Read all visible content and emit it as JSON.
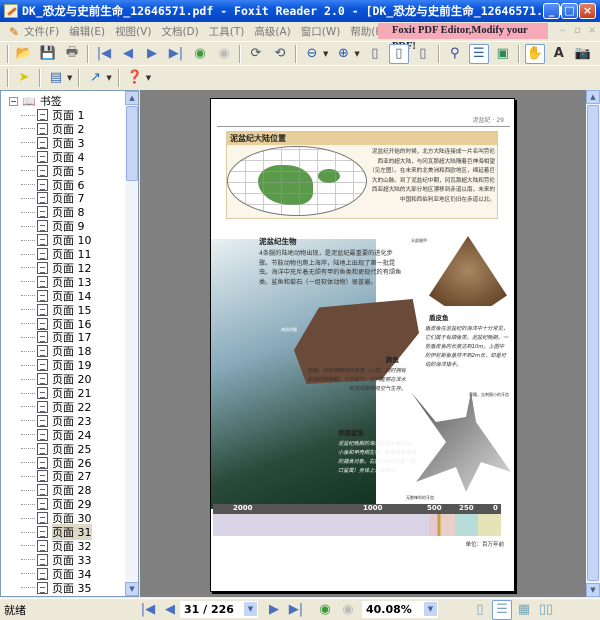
{
  "window": {
    "title": "DK_恐龙与史前生命_12646571.pdf - Foxit Reader 2.0 - [DK_恐龙与史前生命_12646571.pdf]",
    "minimize": "_",
    "maximize": "□",
    "close": "×"
  },
  "menu": [
    "文件(F)",
    "编辑(E)",
    "视图(V)",
    "文档(D)",
    "工具(T)",
    "高级(A)",
    "窗口(W)",
    "帮助(H)"
  ],
  "promo": "Foxit PDF Editor,Modify your PDF!",
  "sidebar": {
    "root": "书签",
    "pages": [
      "页面 1",
      "页面 2",
      "页面 3",
      "页面 4",
      "页面 5",
      "页面 6",
      "页面 7",
      "页面 8",
      "页面 9",
      "页面 10",
      "页面 11",
      "页面 12",
      "页面 13",
      "页面 14",
      "页面 15",
      "页面 16",
      "页面 17",
      "页面 18",
      "页面 19",
      "页面 20",
      "页面 21",
      "页面 22",
      "页面 23",
      "页面 24",
      "页面 25",
      "页面 26",
      "页面 27",
      "页面 28",
      "页面 29",
      "页面 30",
      "页面 31",
      "页面 32",
      "页面 33",
      "页面 34",
      "页面 35"
    ],
    "selected": "页面 31"
  },
  "pdf": {
    "header": "泥盆纪 · 29",
    "map_title": "泥盆纪大陆位置",
    "map_text": "泥盆纪开始的时候，北方大陆连接成一片名叫劳伦西亚的超大陆，与冈瓦那超大陆隔着巨神海相望（见左图）。在未来的北美洲和西欧地区，绵延着巨大的山脉。到了泥盆纪中期，冈瓦那超大陆和劳伦西亚超大陆的大部分地区漂移到赤道以南。未来的中国和西伯利亚地区仍旧在赤道以北。",
    "life_title": "泥盆纪生物",
    "life_text": "4条腿的陆地动物出现，是泥盆纪最重要的进化步骤。节肢动物也爬上海岸，陆地上出现了第一批昆虫。海洋中充斥着无颌有甲的鱼类和更现代的有颌鱼类。鲨鱼和菊石（一组软体动物）很普遍。",
    "shield_label": "头部盾甲",
    "shieldfish_title": "盾皮鱼",
    "shieldfish_text": "盾皮鱼在泥盆纪的海洋中十分常见，它们属于有颌鱼类。泥盆纪晚期，一些盾皮鱼的长度达到10m。上图中的伊尼斯鱼虽然不到2m长，却是可怕的海洋猎手。",
    "fin_label": "肉质的鳍",
    "lungfish_title": "肺鱼",
    "lungfish_text": "肺鱼，例如双鳍目的鱼类（上图）同时拥有原始的肺和鳃。干旱季节，它们能够在浑水的泥洞里呼吸空气生存。",
    "spine_label": "背鳍，尖刺细小的牙齿",
    "shark_title": "早期鲨鱼",
    "shark_text": "泥盆纪晚期的海洋里充斥着乌贼、小鱼和甲壳纲生物，都是鲨鱼理想的捕食对象。右图中的枝齿鲨（裂口鲨属）身体上没有鳞片。",
    "teeth_label": "无数锋利的牙齿",
    "timeline": [
      "2000",
      "1000",
      "500",
      "250",
      "0"
    ],
    "unit": "单位：百万年前"
  },
  "status": {
    "text": "就绪",
    "page": "31 / 226",
    "zoom": "40.08%"
  },
  "colors": {
    "title_bar": "#0a55d8",
    "promo": "#f6a9b6",
    "doc_bg": "#808080",
    "map_green": "#5a9a4a"
  }
}
